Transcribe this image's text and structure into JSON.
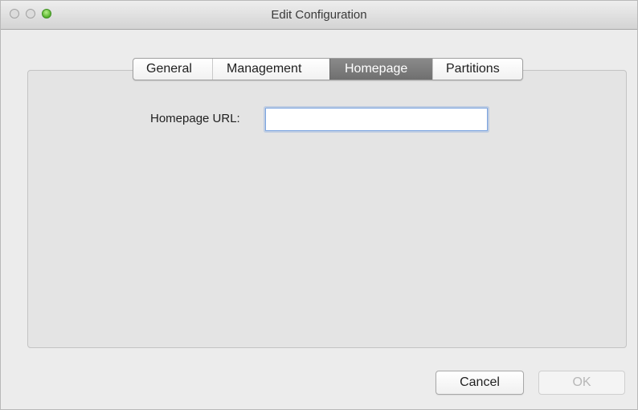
{
  "window": {
    "title": "Edit Configuration"
  },
  "tabs": [
    {
      "label": "General",
      "selected": false
    },
    {
      "label": "Management",
      "selected": false
    },
    {
      "label": "Homepage",
      "selected": true
    },
    {
      "label": "Partitions",
      "selected": false
    }
  ],
  "homepage": {
    "url_label": "Homepage URL:",
    "url_value": "",
    "url_placeholder": ""
  },
  "buttons": {
    "cancel": "Cancel",
    "ok": "OK",
    "ok_enabled": false
  },
  "colors": {
    "zoom_button": "#55b12a",
    "selected_tab": "#777777",
    "focus_ring": "#7aa3df"
  }
}
